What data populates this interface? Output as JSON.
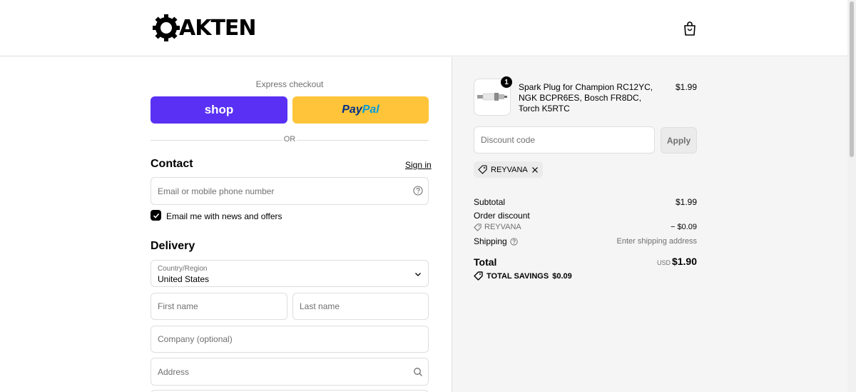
{
  "header": {
    "logo_text": "AKTEN",
    "logo_icon": "gear-o-icon",
    "bag_icon": "shopping-bag-icon"
  },
  "express": {
    "label": "Express checkout",
    "shop_label": "shop",
    "paypal_part1": "Pay",
    "paypal_part2": "Pal",
    "or_text": "OR"
  },
  "contact": {
    "title": "Contact",
    "signin": "Sign in",
    "email_placeholder": "Email or mobile phone number",
    "help_icon": "question-circle-icon",
    "newsletter_label": "Email me with news and offers",
    "newsletter_checked": true
  },
  "delivery": {
    "title": "Delivery",
    "country_label": "Country/Region",
    "country_value": "United States",
    "first_name_placeholder": "First name",
    "last_name_placeholder": "Last name",
    "company_placeholder": "Company (optional)",
    "address_placeholder": "Address"
  },
  "summary": {
    "product": {
      "quantity": "1",
      "name": "Spark Plug for Champion RC12YC, NGK BCPR6ES, Bosch FR8DC, Torch K5RTC",
      "variant": "1",
      "price": "$1.99"
    },
    "discount_placeholder": "Discount code",
    "apply_label": "Apply",
    "applied_code": "REYVANA",
    "subtotal_label": "Subtotal",
    "subtotal_value": "$1.99",
    "order_discount_label": "Order discount",
    "discount_code": "REYVANA",
    "discount_value": "− $0.09",
    "shipping_label": "Shipping",
    "shipping_value": "Enter shipping address",
    "total_label": "Total",
    "currency": "USD",
    "total_value": "$1.90",
    "savings_label": "TOTAL SAVINGS",
    "savings_value": "$0.09"
  },
  "colors": {
    "shop_purple": "#5a31f4",
    "paypal_yellow": "#ffc439",
    "paypal_dark": "#003087",
    "paypal_light": "#009cde"
  }
}
